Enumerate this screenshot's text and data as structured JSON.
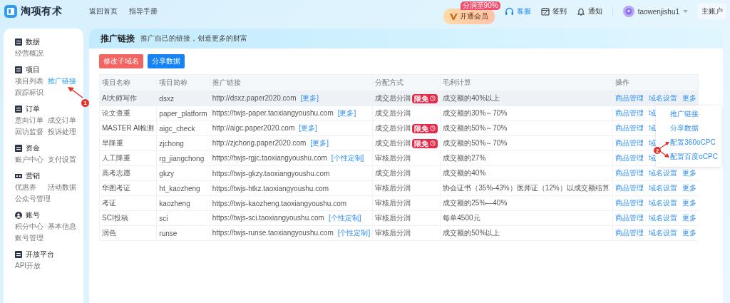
{
  "logo": {
    "text": "淘项有术"
  },
  "nav": [
    {
      "label": "返回首页"
    },
    {
      "label": "指导手册"
    }
  ],
  "vip": {
    "label": "开通会员",
    "badge": "分润至90%"
  },
  "toolbar": [
    {
      "label": "客服",
      "highlighted": true
    },
    {
      "label": "签到",
      "highlighted": false
    },
    {
      "label": "通知",
      "highlighted": false
    }
  ],
  "user": {
    "name": "taowenjishu1",
    "account": "主账户"
  },
  "sidebar": {
    "sections": [
      {
        "title": "数据",
        "items": [
          {
            "label": "经营概况",
            "selected": false
          }
        ]
      },
      {
        "title": "项目",
        "items": [
          {
            "label": "项目列表",
            "selected": false
          },
          {
            "label": "推广链接",
            "selected": true
          },
          {
            "label": "跟踪标识",
            "selected": false
          }
        ]
      },
      {
        "title": "订单",
        "items": [
          {
            "label": "意向订单",
            "selected": false
          },
          {
            "label": "成交订单",
            "selected": false
          },
          {
            "label": "回访监督",
            "selected": false
          },
          {
            "label": "投诉处理",
            "selected": false
          }
        ]
      },
      {
        "title": "资金",
        "items": [
          {
            "label": "账户中心",
            "selected": false
          },
          {
            "label": "支付设置",
            "selected": false
          }
        ]
      },
      {
        "title": "营销",
        "items": [
          {
            "label": "优惠券",
            "selected": false
          },
          {
            "label": "活动数据",
            "selected": false
          },
          {
            "label": "公众号管理",
            "selected": false
          }
        ]
      },
      {
        "title": "账号",
        "items": [
          {
            "label": "积分中心",
            "selected": false
          },
          {
            "label": "基本信息",
            "selected": false
          },
          {
            "label": "账号管理",
            "selected": false
          }
        ]
      },
      {
        "title": "开放平台",
        "items": [
          {
            "label": "API开放",
            "selected": false
          }
        ]
      }
    ]
  },
  "page": {
    "title": "推广链接",
    "subtitle": "推广自己的链接，创造更多的财富"
  },
  "buttons": [
    {
      "label": "修改子域名",
      "kind": "danger"
    },
    {
      "label": "分享数据",
      "kind": "primary"
    }
  ],
  "table": {
    "columns": [
      "项目名称",
      "项目简称",
      "推广链接",
      "分配方式",
      "毛利计算",
      "操作"
    ],
    "rows": [
      {
        "name": "AI大师写作",
        "short": "dsxz",
        "link": "http://dsxz.paper2020.com",
        "link_action": "[更多]",
        "distribution": "成交后分润",
        "badge": "限免",
        "gross": "成交额的40%以上",
        "actions": [
          "商品管理",
          "域名设置",
          "更多"
        ],
        "highlighted": true
      },
      {
        "name": "论文查重",
        "short": "paper_platform",
        "link": "https://twjs-paper.taoxiangyoushu.com",
        "link_action": "[更多]",
        "distribution": "成交后分润",
        "gross": "成交额的30%～70%",
        "actions": [
          "商品管理",
          "域"
        ],
        "highlighted": false
      },
      {
        "name": "MASTER AI检测",
        "short": "aigc_check",
        "link": "http://aigc.paper2020.com",
        "link_action": "[更多]",
        "distribution": "成交后分润",
        "badge": "限免",
        "gross": "成交额的50%～70%",
        "actions": [
          "商品管理",
          "域"
        ],
        "highlighted": false
      },
      {
        "name": "早降重",
        "short": "zjchong",
        "link": "http://zjchong.paper2020.com",
        "link_action": "[更多]",
        "distribution": "成交后分润",
        "badge": "限免",
        "gross": "成交额的50%～70%",
        "actions": [
          "商品管理",
          "域"
        ],
        "highlighted": false
      },
      {
        "name": "人工降重",
        "short": "rg_jiangchong",
        "link": "https://twjs-rgjc.taoxiangyoushu.com",
        "link_action": "[个性定制]",
        "distribution": "审核后分润",
        "gross": "成交额的27%",
        "actions": [
          "商品管理",
          "域"
        ],
        "highlighted": false
      },
      {
        "name": "高考志愿",
        "short": "gkzy",
        "link": "https://twjs-gkzy.taoxiangyoushu.com",
        "distribution": "成交后分润",
        "gross": "成交额的40%",
        "actions": [
          "商品管理",
          "域名设置",
          "更多"
        ],
        "highlighted": false
      },
      {
        "name": "华图考证",
        "short": "ht_kaozheng",
        "link": "https://twjs-htkz.taoxiangyoushu.com",
        "distribution": "审核后分润",
        "gross": "协会证书（35%-43%）医师证（12%）以成交额结算",
        "actions": [
          "商品管理",
          "域名设置",
          "更多"
        ],
        "highlighted": false
      },
      {
        "name": "考证",
        "short": "kaozheng",
        "link": "https://twjs-kaozheng.taoxiangyoushu.com",
        "distribution": "审核后分润",
        "gross": "成交额的25%—40%",
        "actions": [
          "商品管理",
          "域名设置",
          "更多"
        ],
        "highlighted": false
      },
      {
        "name": "SCI投稿",
        "short": "sci",
        "link": "https://twjs-sci.taoxiangyoushu.com",
        "link_action": "[个性定制]",
        "distribution": "审核后分润",
        "gross": "每单4500元",
        "actions": [
          "商品管理",
          "域名设置",
          "更多"
        ],
        "highlighted": false
      },
      {
        "name": "润色",
        "short": "runse",
        "link": "https://twjs-runse.taoxiangyoushu.com",
        "link_action": "[个性定制]",
        "distribution": "审核后分润",
        "gross": "成交额的50%以上",
        "actions": [
          "商品管理",
          "域名设置",
          "更多"
        ],
        "highlighted": false
      }
    ]
  },
  "menu": {
    "items": [
      "推广链接",
      "分享数据",
      "配置360oCPC",
      "配置百度oCPC"
    ]
  },
  "annotations": [
    {
      "label": "1"
    },
    {
      "label": "2"
    }
  ]
}
